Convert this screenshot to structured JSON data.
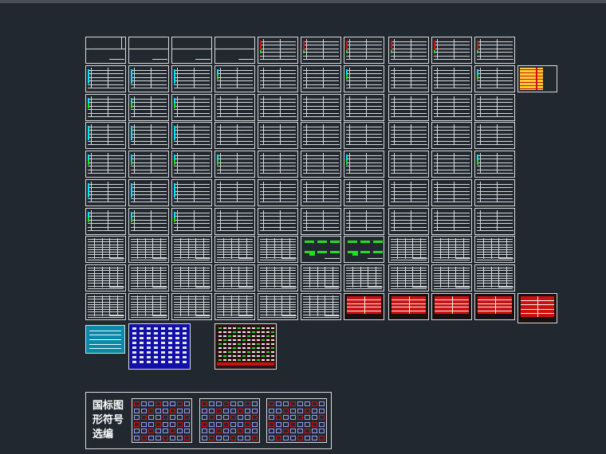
{
  "window": {
    "background": "#212830",
    "topbar_color": "#4b5058"
  },
  "colors": {
    "line": "#d8d8d8",
    "cyan": "#00e5ff",
    "green": "#22dd22",
    "red": "#cc1111",
    "yellow": "#ffcc33",
    "blue": "#1111aa"
  },
  "sheet_grid": {
    "rows": 10,
    "cols": 10
  },
  "extra_sheets": {
    "side_sheet": "yellow-table",
    "bottom_right_sheet": "red-table"
  },
  "symbol_sheets": [
    "cyan-notes",
    "blue-symbols",
    "red-symbols"
  ],
  "legend": {
    "title_lines": [
      "国标图",
      "形符号",
      "选编"
    ],
    "sheets": [
      "symbol-table-1",
      "symbol-table-2",
      "symbol-table-3"
    ]
  }
}
